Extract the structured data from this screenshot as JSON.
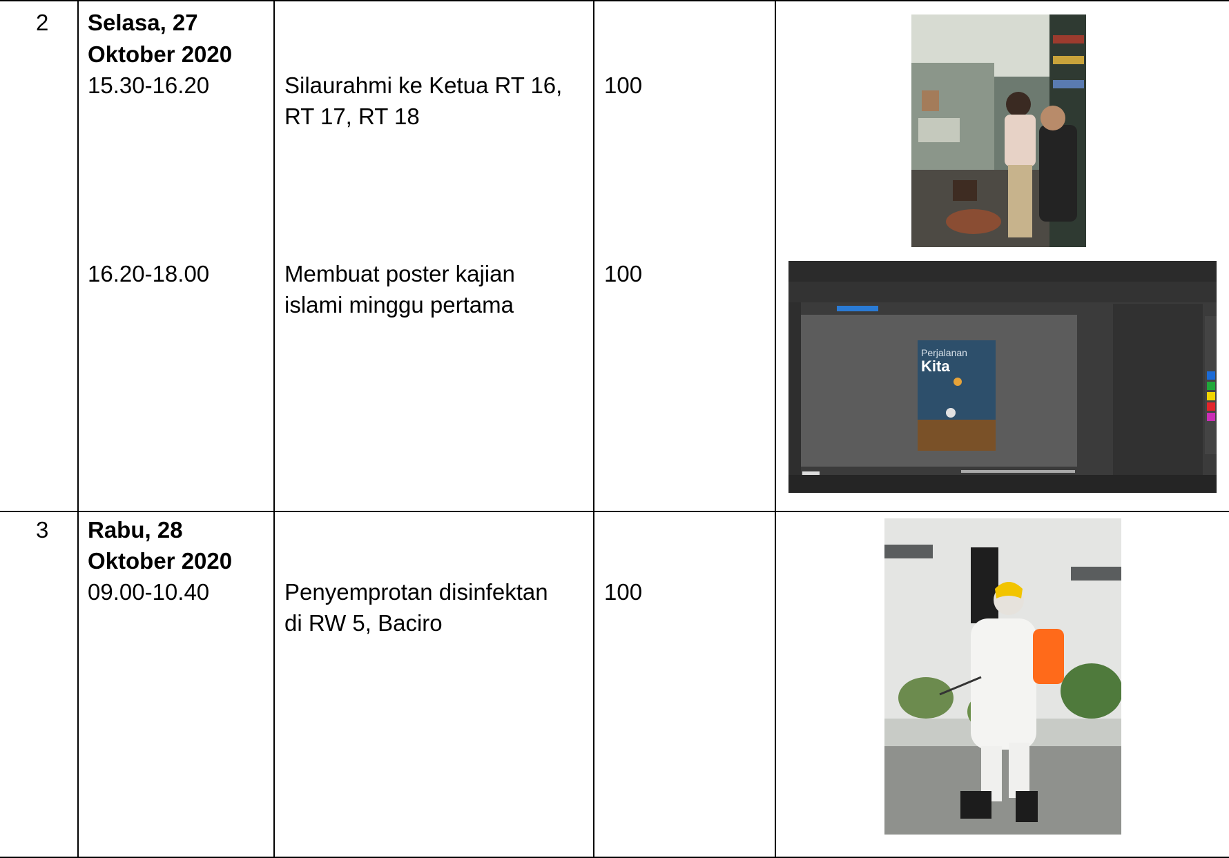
{
  "rows": [
    {
      "number": "2",
      "day": "Selasa, 27",
      "date": "Oktober 2020",
      "entries": [
        {
          "time": "15.30-16.20",
          "activity": [
            "Silaurahmi ke Ketua RT 16,",
            "RT 17,  RT 18"
          ],
          "percent": "100",
          "photo": "photo-shop-visit"
        },
        {
          "time": "16.20-18.00",
          "activity": [
            "Membuat poster kajian",
            "islami minggu pertama"
          ],
          "percent": "100",
          "photo": "screenshot-design-software",
          "screen_text": [
            "Perjalanan",
            "Kita"
          ]
        }
      ]
    },
    {
      "number": "3",
      "day": "Rabu, 28",
      "date": "Oktober 2020",
      "entries": [
        {
          "time": "09.00-10.40",
          "activity": [
            "Penyemprotan disinfektan",
            "di RW 5, Baciro"
          ],
          "percent": "100",
          "photo": "photo-disinfectant-spraying"
        }
      ]
    }
  ],
  "colors": {
    "border": "#000000",
    "text": "#000000",
    "app_dark": "#3a3a3a",
    "app_canvas": "#5c5c5c",
    "wall": "#e4e5e3",
    "helmet": "#f2c400",
    "tank": "#ff6a1a"
  }
}
